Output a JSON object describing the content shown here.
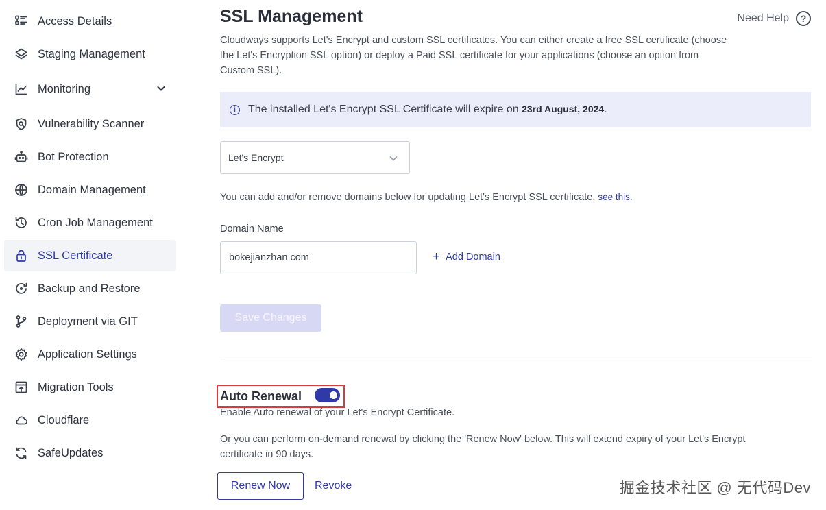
{
  "sidebar": {
    "items": [
      {
        "label": "Access Details",
        "icon": "list-icon",
        "active": false
      },
      {
        "label": "Staging Management",
        "icon": "layers-icon",
        "active": false
      },
      {
        "label": "Monitoring",
        "icon": "chart-line-icon",
        "active": false,
        "expandable": true
      },
      {
        "label": "Vulnerability Scanner",
        "icon": "shield-scan-icon",
        "active": false
      },
      {
        "label": "Bot Protection",
        "icon": "robot-icon",
        "active": false
      },
      {
        "label": "Domain Management",
        "icon": "www-globe-icon",
        "active": false
      },
      {
        "label": "Cron Job Management",
        "icon": "history-icon",
        "active": false
      },
      {
        "label": "SSL Certificate",
        "icon": "lock-icon",
        "active": true
      },
      {
        "label": "Backup and Restore",
        "icon": "backup-icon",
        "active": false
      },
      {
        "label": "Deployment via GIT",
        "icon": "git-branch-icon",
        "active": false
      },
      {
        "label": "Application Settings",
        "icon": "gear-icon",
        "active": false
      },
      {
        "label": "Migration Tools",
        "icon": "migration-icon",
        "active": false
      },
      {
        "label": "Cloudflare",
        "icon": "cloud-icon",
        "active": false
      },
      {
        "label": "SafeUpdates",
        "icon": "refresh-icon",
        "active": false
      }
    ]
  },
  "main": {
    "title": "SSL Management",
    "need_help": "Need Help",
    "help_icon": "?",
    "intro": "Cloudways supports Let's Encrypt and custom SSL certificates. You can either create a free SSL certificate (choose the Let's Encryption SSL option) or deploy a Paid SSL certificate for your applications (choose an option from Custom SSL).",
    "banner": {
      "message": "The installed Let's Encrypt SSL Certificate will expire on ",
      "date": "23rd August, 2024",
      "suffix": "."
    },
    "ssl_type_select": {
      "value": "Let's Encrypt"
    },
    "domain_note": "You can add and/or remove domains below for updating Let's Encrypt SSL certificate. ",
    "domain_note_link": "see this.",
    "domain_label": "Domain Name",
    "domain_value": "bokejianzhan.com",
    "add_domain": "Add Domain",
    "add_domain_glyph": "+",
    "save_button": "Save Changes",
    "auto_renewal": {
      "title": "Auto Renewal",
      "enabled": true,
      "description": "Enable Auto renewal of your Let's Encrypt Certificate.",
      "renew_description": "Or you can perform on-demand renewal by clicking the 'Renew Now' below. This will extend expiry of your Let's Encrypt certificate in 90 days."
    },
    "renew_button": "Renew Now",
    "revoke_link": "Revoke"
  },
  "watermark": "掘金技术社区 @ 无代码Dev",
  "colors": {
    "accent": "#2f3aa8",
    "banner_bg": "#ecedfb",
    "highlight_border": "#d9393f",
    "disabled_button": "#d7d9f4"
  }
}
